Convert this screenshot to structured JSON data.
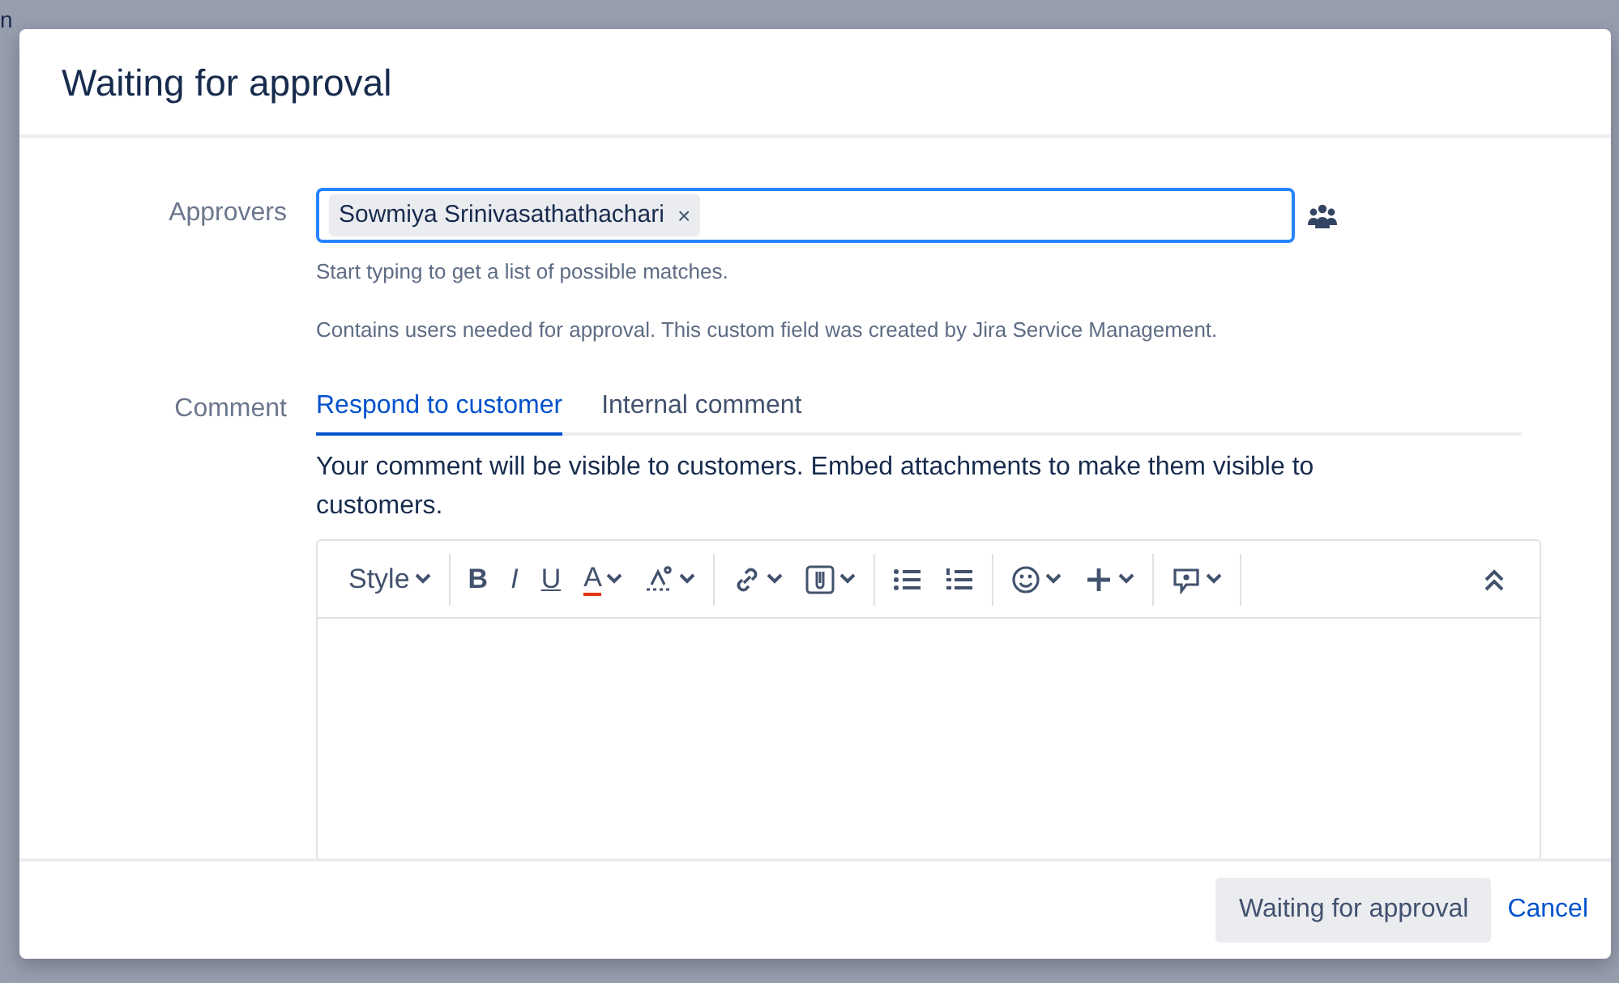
{
  "backdrop": {
    "texts": [
      "n"
    ]
  },
  "dialog": {
    "title": "Waiting for approval",
    "approvers": {
      "label": "Approvers",
      "chips": [
        "Sowmiya Srinivasathathachari"
      ],
      "remove": "×",
      "help": [
        "Start typing to get a list of possible matches.",
        "Contains users needed for approval. This custom field was created by Jira Service Management."
      ]
    },
    "comment": {
      "label": "Comment",
      "tabs": [
        {
          "label": "Respond to customer",
          "selected": true
        },
        {
          "label": "Internal comment",
          "selected": false
        }
      ],
      "notice": "Your comment will be visible to customers. Embed attachments to make them visible to customers.",
      "toolbar": [
        [
          {
            "kind": "style",
            "label": "Style",
            "caret": true
          }
        ],
        [
          {
            "kind": "bold",
            "label": "B",
            "caret": false
          },
          {
            "kind": "italic",
            "label": "I",
            "caret": false
          },
          {
            "kind": "underline",
            "label": "U",
            "caret": false
          },
          {
            "kind": "color",
            "label": "A",
            "caret": true
          },
          {
            "kind": "format",
            "caret": true
          }
        ],
        [
          {
            "kind": "link",
            "caret": true
          },
          {
            "kind": "attach",
            "caret": true
          }
        ],
        [
          {
            "kind": "bullets",
            "caret": false
          },
          {
            "kind": "numbers",
            "caret": false
          }
        ],
        [
          {
            "kind": "emoji",
            "caret": true
          },
          {
            "kind": "plus",
            "caret": true
          }
        ],
        [
          {
            "kind": "feedback",
            "caret": true
          }
        ],
        [
          {
            "kind": "collapse",
            "caret": false
          }
        ]
      ]
    },
    "buttons": [
      {
        "kind": "primary",
        "label": "Waiting for approval"
      },
      {
        "kind": "link",
        "label": "Cancel"
      }
    ]
  }
}
